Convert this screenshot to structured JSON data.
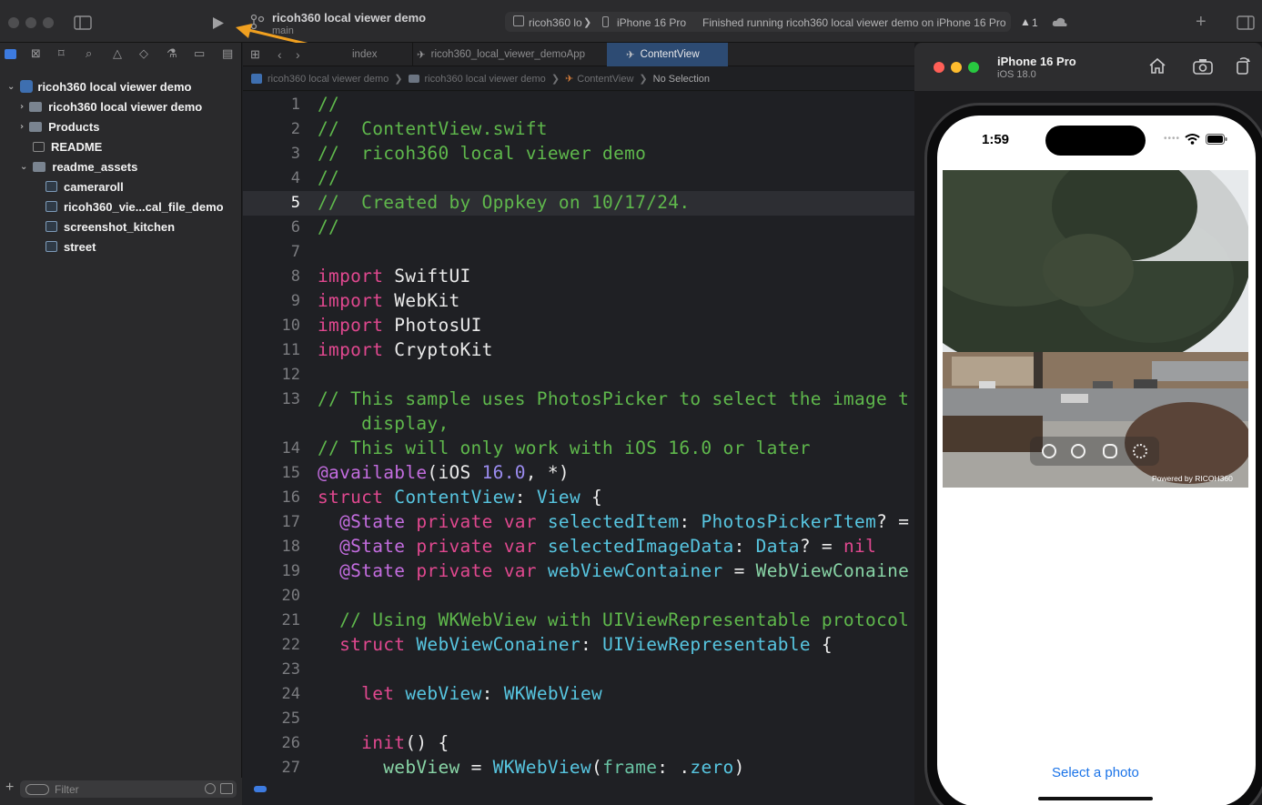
{
  "window": {
    "project_title": "ricoh360 local viewer demo",
    "branch": "main",
    "scheme": "ricoh360 lo",
    "destination": "iPhone 16 Pro",
    "status": "Finished running ricoh360 local viewer demo on iPhone 16 Pro",
    "warnings": "1"
  },
  "navigator": {
    "items": [
      {
        "label": "ricoh360 local viewer demo"
      },
      {
        "label": "ricoh360 local viewer demo"
      },
      {
        "label": "Products"
      },
      {
        "label": "README"
      },
      {
        "label": "readme_assets"
      },
      {
        "label": "cameraroll"
      },
      {
        "label": "ricoh360_vie...cal_file_demo"
      },
      {
        "label": "screenshot_kitchen"
      },
      {
        "label": "street"
      }
    ],
    "filter_placeholder": "Filter"
  },
  "tabs": [
    {
      "label": "index"
    },
    {
      "label": "ricoh360_local_viewer_demoApp"
    },
    {
      "label": "ContentView"
    }
  ],
  "jumpbar": {
    "crumb1": "ricoh360 local viewer demo",
    "crumb2": "ricoh360 local viewer demo",
    "crumb3": "ContentView",
    "crumb4": "No Selection"
  },
  "editor": {
    "line_numbers": [
      "1",
      "2",
      "3",
      "4",
      "5",
      "6",
      "7",
      "8",
      "9",
      "10",
      "11",
      "12",
      "13",
      "14",
      "15",
      "16",
      "17",
      "18",
      "19",
      "20",
      "21",
      "22",
      "23",
      "24",
      "25",
      "26",
      "27"
    ]
  },
  "simulator": {
    "device": "iPhone 16 Pro",
    "os": "iOS 18.0",
    "time": "1:59",
    "powered_by": "Powered by RICOH360",
    "select_photo": "Select a photo"
  }
}
